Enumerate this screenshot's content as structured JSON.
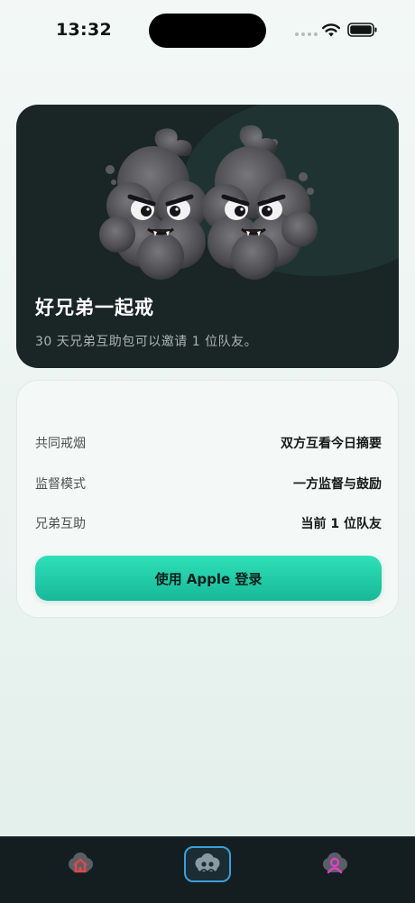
{
  "status_bar": {
    "time": "13:32"
  },
  "hero": {
    "title": "好兄弟一起戒",
    "subtitle": "30 天兄弟互助包可以邀请 1 位队友。"
  },
  "info": {
    "rows": [
      {
        "label": "共同戒烟",
        "value": "双方互看今日摘要"
      },
      {
        "label": "监督模式",
        "value": "一方监督与鼓励"
      },
      {
        "label": "兄弟互助",
        "value": "当前 1 位队友"
      }
    ],
    "login_button": "使用 Apple 登录"
  },
  "tabs": [
    {
      "icon": "home-icon",
      "active": false
    },
    {
      "icon": "buddies-icon",
      "active": true
    },
    {
      "icon": "profile-icon",
      "active": false
    }
  ],
  "colors": {
    "accent": "#22cfa8",
    "hero_bg": "#1a2526",
    "tab_active_border": "#3aa0d8",
    "home_icon": "#e04848",
    "profile_icon": "#e040c8"
  }
}
